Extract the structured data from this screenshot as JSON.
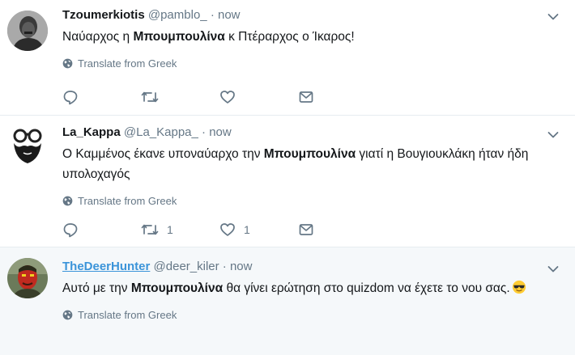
{
  "tweets": [
    {
      "name": "Tzoumerkiotis",
      "handle": "@pamblo_",
      "dot": "·",
      "time": "now",
      "text_before": "Ναύαρχος η ",
      "text_bold": "Μπουμπουλίνα",
      "text_after": " κ Πτέραρχος ο Ίκαρος!",
      "translate_label": "Translate from Greek",
      "reply_count": "",
      "retweet_count": "",
      "like_count": "",
      "avatar_icon": "man-portrait-avatar"
    },
    {
      "name": "La_Kappa",
      "handle": "@La_Kappa_",
      "dot": "·",
      "time": "now",
      "text_before": "Ο Καμμένος έκανε υποναύαρχο την ",
      "text_bold": "Μπουμπουλίνα",
      "text_after": " γιατί η Βουγιουκλάκη ήταν ήδη υπολοχαγός",
      "translate_label": "Translate from Greek",
      "reply_count": "",
      "retweet_count": "1",
      "like_count": "1",
      "avatar_icon": "glasses-beard-avatar"
    },
    {
      "name": "TheDeerHunter",
      "handle": "@deer_kiler",
      "dot": "·",
      "time": "now",
      "text_before": "Αυτό με την ",
      "text_bold": "Μπουμπουλίνα",
      "text_after": " θα γίνει ερώτηση στο quizdom να έχετε το νου σας.",
      "translate_label": "Translate from Greek",
      "avatar_icon": "painted-face-avatar",
      "emoji": "sunglasses-emoji"
    }
  ],
  "icons": {
    "reply": "reply-icon",
    "retweet": "retweet-icon",
    "like": "heart-icon",
    "message": "envelope-icon",
    "translate": "globe-icon",
    "menu": "chevron-down-icon"
  },
  "colors": {
    "link": "#3b94d9",
    "muted": "#657786",
    "text": "#14171a",
    "highlight_bg": "#f5f8fa",
    "border": "#e6ecf0"
  }
}
